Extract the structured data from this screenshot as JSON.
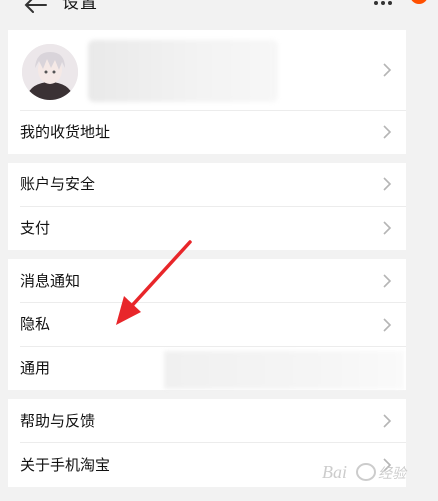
{
  "header": {
    "title": "设置",
    "back_icon": "back-arrow-icon",
    "more_icon": "more-dots-icon"
  },
  "profile": {
    "avatar_icon": "user-avatar",
    "name_blurred": true
  },
  "rows": {
    "address": "我的收货地址",
    "account_security": "账户与安全",
    "payment": "支付",
    "notifications": "消息通知",
    "privacy": "隐私",
    "general": "通用",
    "help_feedback": "帮助与反馈",
    "about": "关于手机淘宝"
  },
  "colors": {
    "background": "#f2f2f2",
    "card": "#ffffff",
    "annotation_arrow": "#e8262a",
    "notification_badge": "#ff5000"
  },
  "watermark_text": "Bai 经验"
}
